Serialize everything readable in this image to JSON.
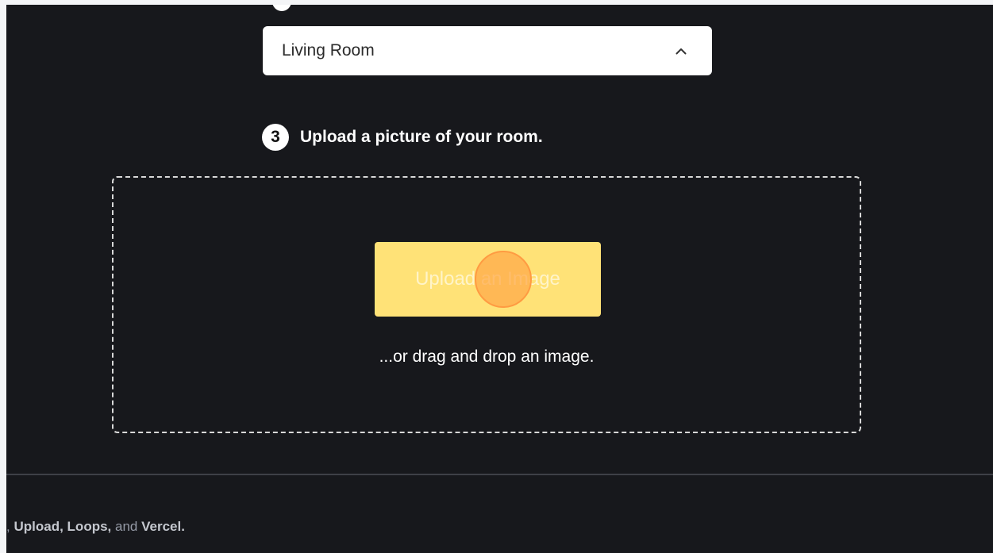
{
  "room_type": {
    "selected": "Living Room",
    "chevron_icon": "chevron-up-icon"
  },
  "step3": {
    "number": "3",
    "label": "Upload a picture of your room."
  },
  "dropzone": {
    "button_label": "Upload an Image",
    "drag_text": "...or drag and drop an image."
  },
  "footer": {
    "partial_lead": ",",
    "upload": "Upload,",
    "loops": "Loops,",
    "and": "and",
    "vercel": "Vercel."
  },
  "colors": {
    "background": "#17181c",
    "button": "#ffe277",
    "cursor_highlight": "#ff9b42"
  }
}
